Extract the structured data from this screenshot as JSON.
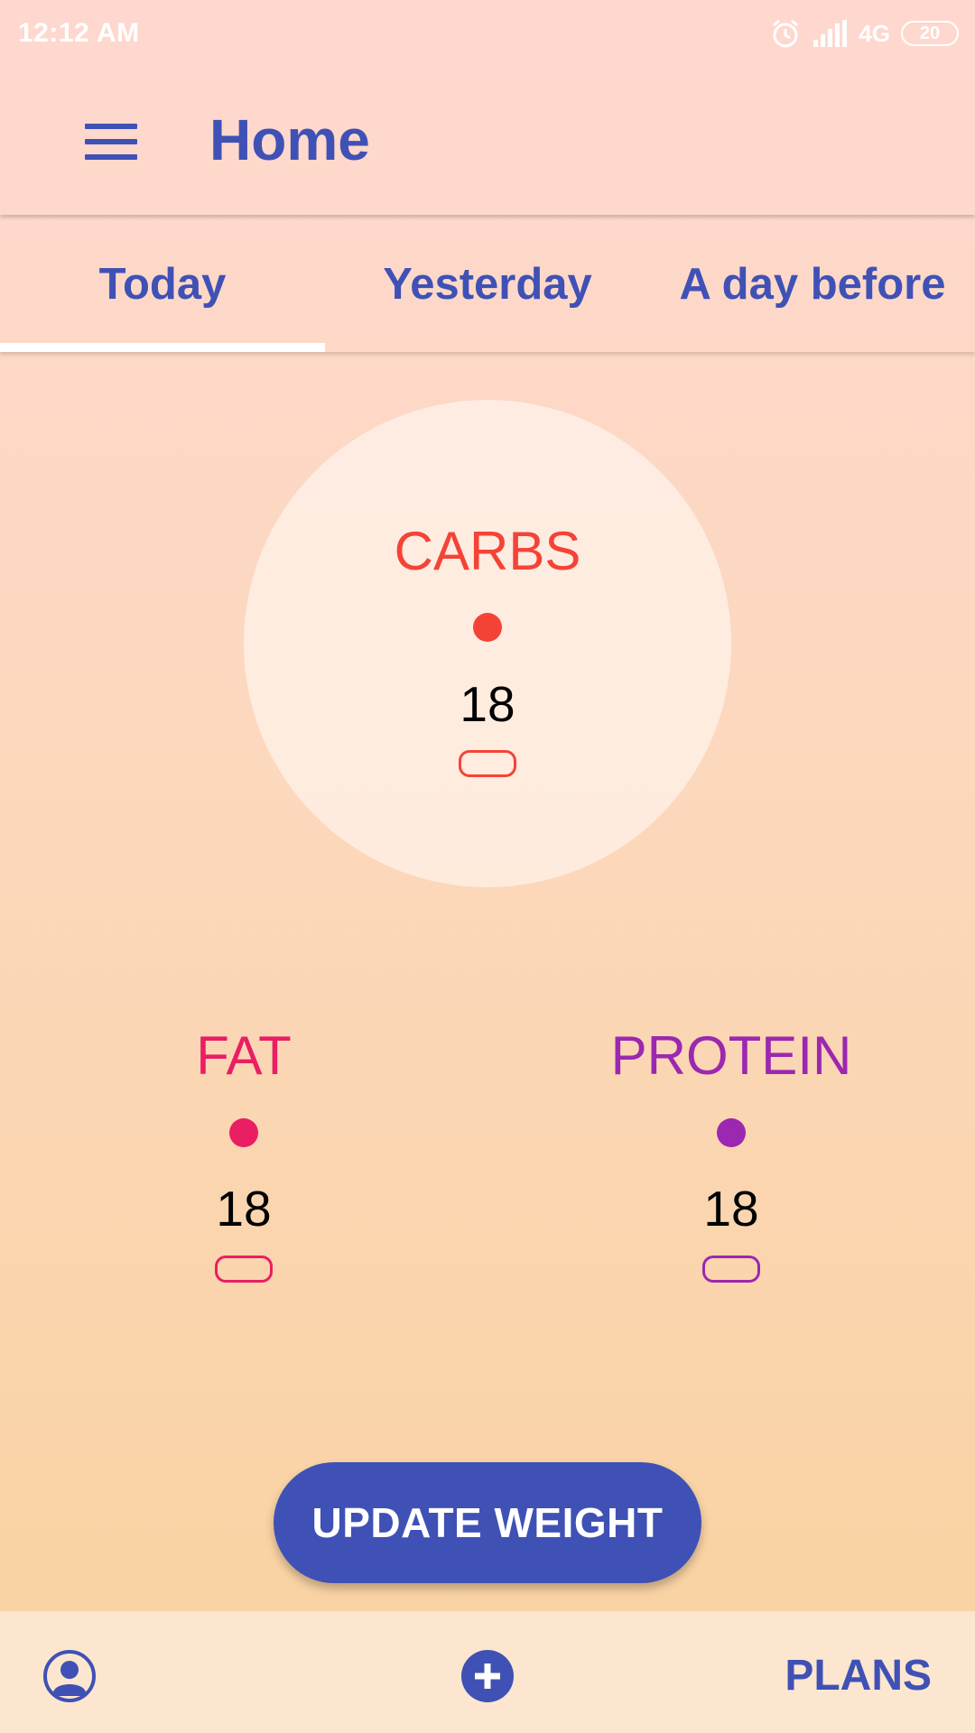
{
  "status_bar": {
    "time": "12:12 AM",
    "network": "4G",
    "battery": "20"
  },
  "app_bar": {
    "title": "Home",
    "menu_icon": "hamburger-menu-icon"
  },
  "tabs": [
    {
      "label": "Today",
      "selected": true
    },
    {
      "label": "Yesterday",
      "selected": false
    },
    {
      "label": "A day before",
      "selected": false
    }
  ],
  "macros": {
    "carbs": {
      "label": "CARBS",
      "value": "18",
      "color": "#f44336"
    },
    "fat": {
      "label": "FAT",
      "value": "18",
      "color": "#e91e63"
    },
    "protein": {
      "label": "PROTEIN",
      "value": "18",
      "color": "#9c27b0"
    }
  },
  "update_button": {
    "label": "UPDATE WEIGHT"
  },
  "bottom_bar": {
    "profile_icon": "profile-icon",
    "add_icon": "add-circle-icon",
    "plans_label": "PLANS"
  },
  "colors": {
    "primary": "#3f51b5",
    "accent_white": "#ffffff"
  }
}
